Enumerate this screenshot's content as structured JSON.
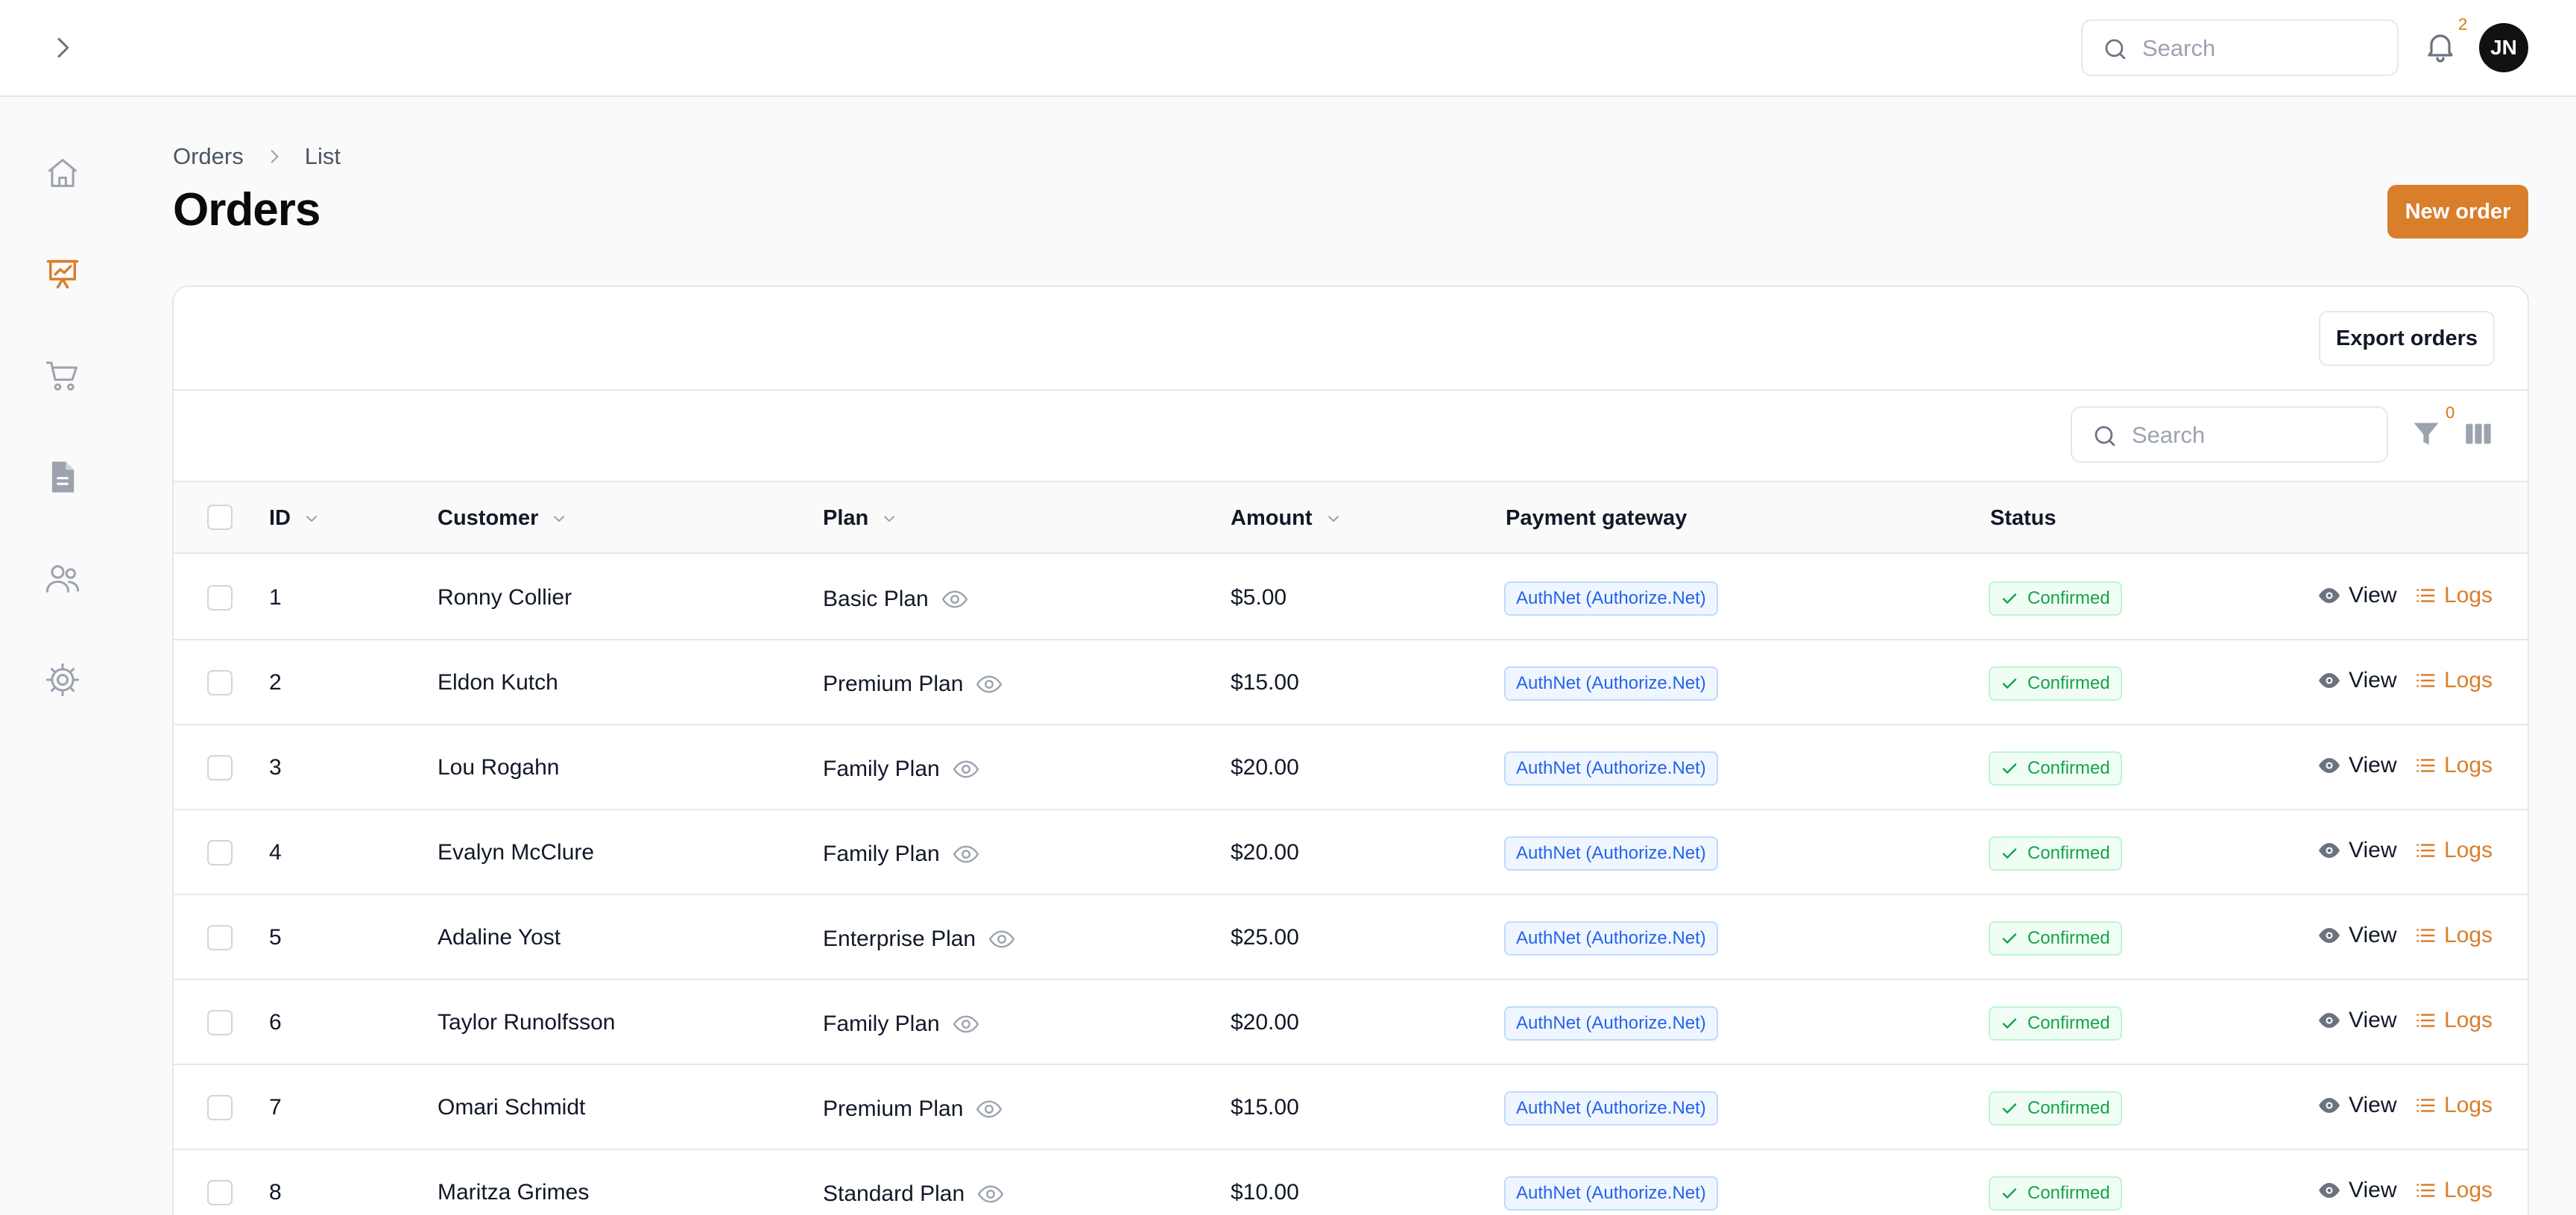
{
  "topbar": {
    "search_placeholder": "Search",
    "notification_count": "2",
    "avatar_initials": "JN"
  },
  "sidebar": {
    "items": [
      {
        "icon": "home-icon",
        "active": false
      },
      {
        "icon": "chart-icon",
        "active": true
      },
      {
        "icon": "cart-icon",
        "active": false
      },
      {
        "icon": "document-icon",
        "active": false
      },
      {
        "icon": "users-icon",
        "active": false
      },
      {
        "icon": "settings-icon",
        "active": false
      }
    ]
  },
  "breadcrumb": {
    "items": [
      "Orders",
      "List"
    ]
  },
  "page": {
    "title": "Orders",
    "new_order_label": "New order"
  },
  "card": {
    "export_label": "Export orders",
    "search_placeholder": "Search",
    "filter_count": "0"
  },
  "table": {
    "headers": {
      "id": "ID",
      "customer": "Customer",
      "plan": "Plan",
      "amount": "Amount",
      "gateway": "Payment gateway",
      "status": "Status"
    },
    "action_view": "View",
    "action_logs": "Logs",
    "rows": [
      {
        "id": "1",
        "customer": "Ronny Collier",
        "plan": "Basic Plan",
        "amount": "$5.00",
        "gateway": "AuthNet (Authorize.Net)",
        "status": "Confirmed"
      },
      {
        "id": "2",
        "customer": "Eldon Kutch",
        "plan": "Premium Plan",
        "amount": "$15.00",
        "gateway": "AuthNet (Authorize.Net)",
        "status": "Confirmed"
      },
      {
        "id": "3",
        "customer": "Lou Rogahn",
        "plan": "Family Plan",
        "amount": "$20.00",
        "gateway": "AuthNet (Authorize.Net)",
        "status": "Confirmed"
      },
      {
        "id": "4",
        "customer": "Evalyn McClure",
        "plan": "Family Plan",
        "amount": "$20.00",
        "gateway": "AuthNet (Authorize.Net)",
        "status": "Confirmed"
      },
      {
        "id": "5",
        "customer": "Adaline Yost",
        "plan": "Enterprise Plan",
        "amount": "$25.00",
        "gateway": "AuthNet (Authorize.Net)",
        "status": "Confirmed"
      },
      {
        "id": "6",
        "customer": "Taylor Runolfsson",
        "plan": "Family Plan",
        "amount": "$20.00",
        "gateway": "AuthNet (Authorize.Net)",
        "status": "Confirmed"
      },
      {
        "id": "7",
        "customer": "Omari Schmidt",
        "plan": "Premium Plan",
        "amount": "$15.00",
        "gateway": "AuthNet (Authorize.Net)",
        "status": "Confirmed"
      },
      {
        "id": "8",
        "customer": "Maritza Grimes",
        "plan": "Standard Plan",
        "amount": "$10.00",
        "gateway": "AuthNet (Authorize.Net)",
        "status": "Confirmed"
      }
    ]
  },
  "colors": {
    "accent": "#d97e2b",
    "gateway_text": "#2563eb",
    "status_text": "#16a34a"
  }
}
